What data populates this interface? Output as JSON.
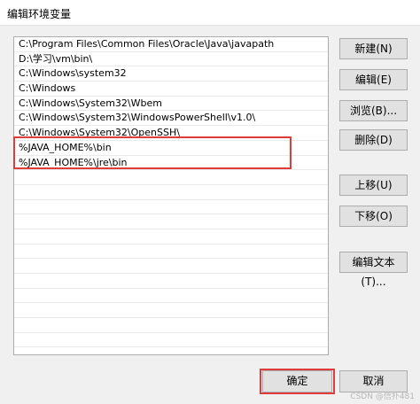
{
  "window": {
    "title": "编辑环境变量"
  },
  "path_list": {
    "items": [
      "C:\\Program Files\\Common Files\\Oracle\\Java\\javapath",
      "D:\\学习\\vm\\bin\\",
      "C:\\Windows\\system32",
      "C:\\Windows",
      "C:\\Windows\\System32\\Wbem",
      "C:\\Windows\\System32\\WindowsPowerShell\\v1.0\\",
      "C:\\Windows\\System32\\OpenSSH\\",
      "%JAVA_HOME%\\bin",
      "%JAVA_HOME%\\jre\\bin"
    ]
  },
  "buttons": {
    "new": "新建(N)",
    "edit": "编辑(E)",
    "browse": "浏览(B)...",
    "delete": "删除(D)",
    "move_up": "上移(U)",
    "move_down": "下移(O)",
    "edit_text": "编辑文本(T)...",
    "ok": "确定",
    "cancel": "取消"
  },
  "watermark": "CSDN @信扑481"
}
